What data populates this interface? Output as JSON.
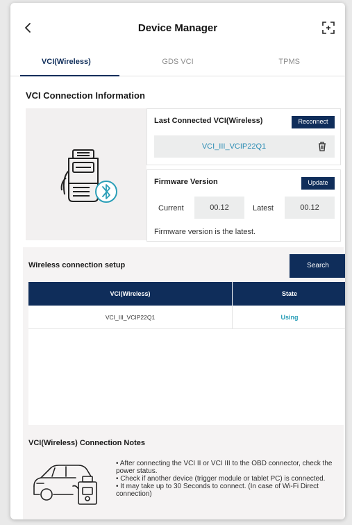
{
  "header": {
    "title": "Device Manager",
    "back_icon": "chevron-left-icon",
    "expand_icon": "expand-icon"
  },
  "tabs": [
    {
      "label": "VCI(Wireless)",
      "active": true
    },
    {
      "label": "GDS VCI",
      "active": false
    },
    {
      "label": "TPMS",
      "active": false
    }
  ],
  "connection_info": {
    "section_title": "VCI Connection Information",
    "device_icon": "vci-bluetooth-device-icon",
    "last_connected": {
      "title": "Last Connected VCI(Wireless)",
      "reconnect_label": "Reconnect",
      "vci_name": "VCI_III_VCIP22Q1",
      "delete_icon": "trash-icon"
    },
    "firmware": {
      "title": "Firmware Version",
      "update_label": "Update",
      "current_label": "Current",
      "current_value": "00.12",
      "latest_label": "Latest",
      "latest_value": "00.12",
      "status": "Firmware version is the latest."
    }
  },
  "wireless_setup": {
    "title": "Wireless connection setup",
    "search_label": "Search",
    "columns": [
      "VCI(Wireless)",
      "State"
    ],
    "rows": [
      {
        "vci": "VCI_III_VCIP22Q1",
        "state": "Using"
      }
    ]
  },
  "notes": {
    "title": "VCI(Wireless) Connection Notes",
    "icon": "car-obd-connector-icon",
    "items": [
      "• After connecting the VCI II or VCI III to the OBD connector, check the power status.",
      "• Check if another device (trigger module or tablet PC) is connected.",
      "• It may take up to 30 Seconds to connect. (In case of Wi-Fi Direct connection)"
    ]
  },
  "colors": {
    "primary": "#0f2d5a",
    "accent_text": "#2b8cb4",
    "state_text": "#2b9fb8",
    "panel_bg": "#f5f3f3"
  }
}
